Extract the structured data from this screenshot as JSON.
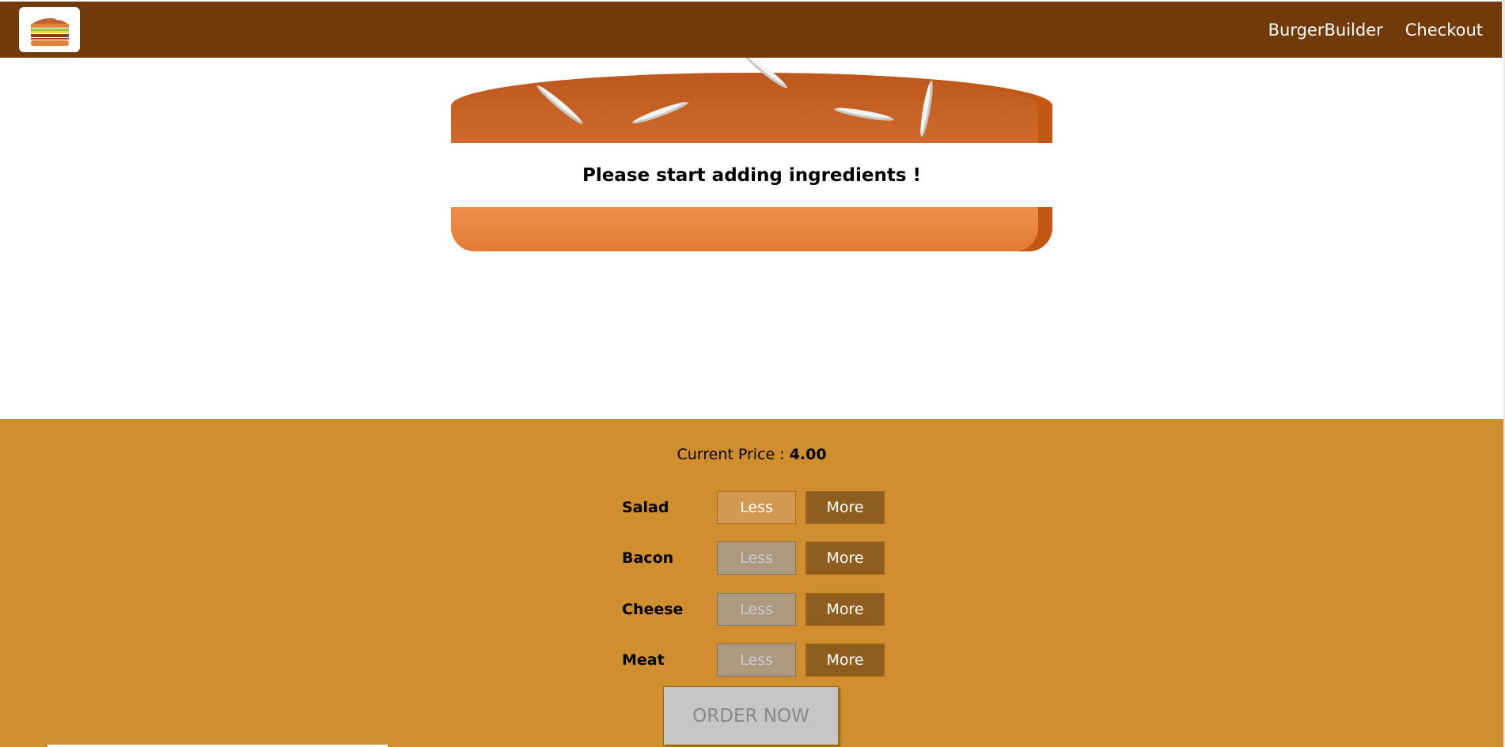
{
  "toolbar": {
    "logo_icon": "burger-logo-icon",
    "nav": [
      {
        "label": "BurgerBuilder"
      },
      {
        "label": "Checkout"
      }
    ]
  },
  "burger": {
    "message": "Please start adding ingredients !"
  },
  "controls": {
    "price_label": "Current Price : ",
    "price_value": "4.00",
    "items": [
      {
        "label": "Salad",
        "less": "Less",
        "more": "More",
        "less_disabled": false
      },
      {
        "label": "Bacon",
        "less": "Less",
        "more": "More",
        "less_disabled": true
      },
      {
        "label": "Cheese",
        "less": "Less",
        "more": "More",
        "less_disabled": true
      },
      {
        "label": "Meat",
        "less": "Less",
        "more": "More",
        "less_disabled": true
      }
    ],
    "order_label": "ORDER NOW"
  },
  "colors": {
    "toolbar": "#703b09",
    "controls_bg": "#cf8f2e",
    "bun": "#e27b36",
    "more_button": "#8f5e1e"
  }
}
